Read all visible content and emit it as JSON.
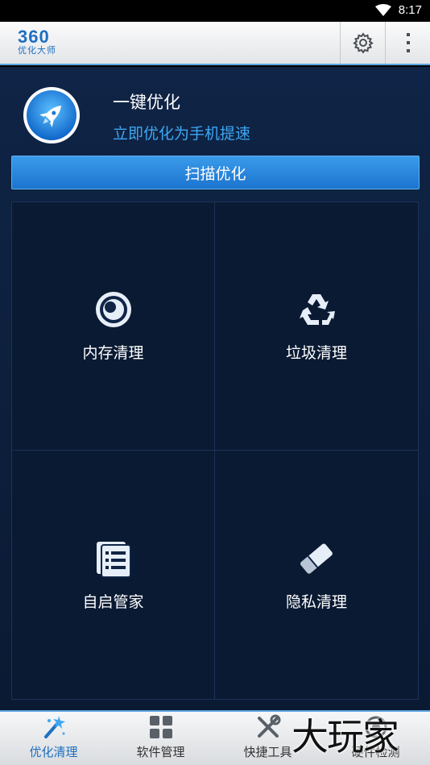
{
  "status_bar": {
    "time": "8:17"
  },
  "app": {
    "logo_number": "360",
    "logo_text": "优化大师"
  },
  "optimize": {
    "title": "一键优化",
    "subtitle": "立即优化为手机提速",
    "scan_button": "扫描优化"
  },
  "tiles": [
    {
      "label": "内存清理",
      "icon": "memory-icon"
    },
    {
      "label": "垃圾清理",
      "icon": "recycle-icon"
    },
    {
      "label": "自启管家",
      "icon": "startup-list-icon"
    },
    {
      "label": "隐私清理",
      "icon": "eraser-icon"
    }
  ],
  "bottom_nav": [
    {
      "label": "优化清理",
      "icon": "magic-wand-icon",
      "active": true
    },
    {
      "label": "软件管理",
      "icon": "apps-grid-icon",
      "active": false
    },
    {
      "label": "快捷工具",
      "icon": "tools-icon",
      "active": false
    },
    {
      "label": "硬件检测",
      "icon": "hardware-icon",
      "active": false
    }
  ],
  "watermark": "大玩家",
  "colors": {
    "accent": "#1e6fc2",
    "link": "#3ea7f3",
    "background": "#0f2446"
  }
}
